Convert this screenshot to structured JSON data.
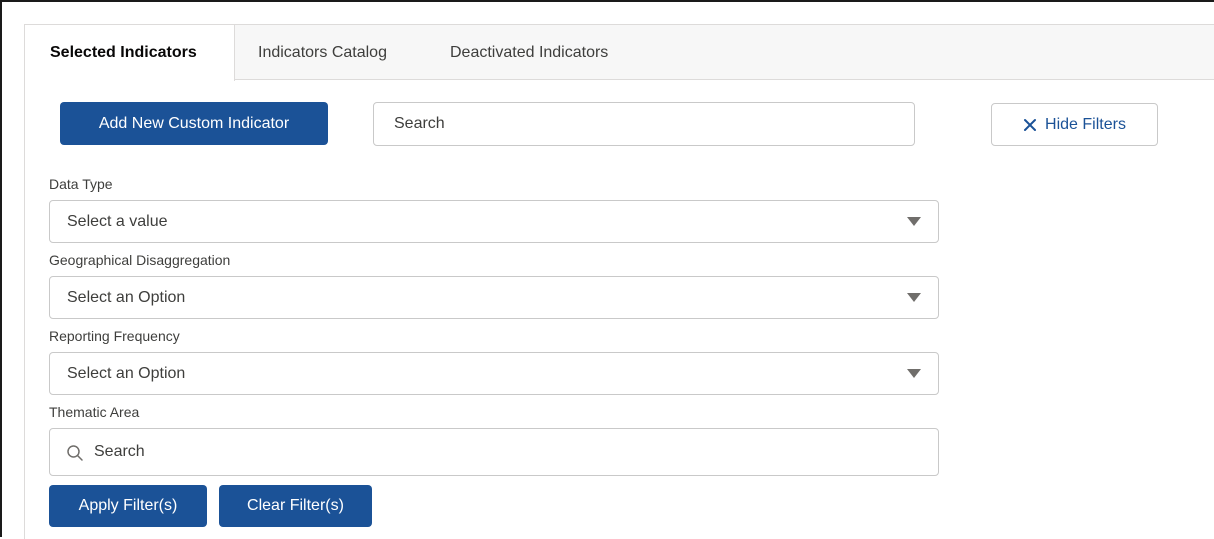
{
  "tabs": [
    {
      "label": "Selected Indicators",
      "active": true
    },
    {
      "label": "Indicators Catalog",
      "active": false
    },
    {
      "label": "Deactivated Indicators",
      "active": false
    }
  ],
  "toolbar": {
    "add_button_label": "Add New Custom Indicator",
    "search_placeholder": "Search",
    "hide_filters_label": "Hide Filters",
    "hide_filters_icon": "close-icon"
  },
  "filters": {
    "data_type": {
      "label": "Data Type",
      "value": "Select a value"
    },
    "geo_disaggregation": {
      "label": "Geographical Disaggregation",
      "value": "Select an Option"
    },
    "reporting_frequency": {
      "label": "Reporting Frequency",
      "value": "Select an Option"
    },
    "thematic_area": {
      "label": "Thematic Area",
      "placeholder": "Search",
      "icon": "search-icon"
    }
  },
  "actions": {
    "apply_label": "Apply Filter(s)",
    "clear_label": "Clear Filter(s)"
  },
  "colors": {
    "brand": "#1b5297",
    "border": "#c9c9c9",
    "tab_background": "#f7f7f7"
  }
}
